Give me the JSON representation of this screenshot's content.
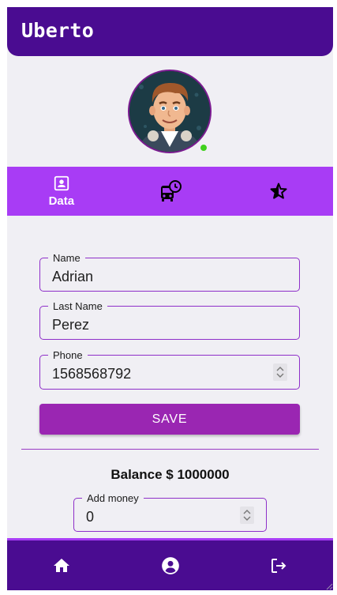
{
  "app": {
    "title": "Uberto"
  },
  "tabs": [
    {
      "label": "Data",
      "icon": "contact-card-icon",
      "active": true
    },
    {
      "label": "",
      "icon": "bus-clock-icon",
      "active": false
    },
    {
      "label": "",
      "icon": "star-half-icon",
      "active": false
    }
  ],
  "form": {
    "name": {
      "label": "Name",
      "value": "Adrian"
    },
    "last_name": {
      "label": "Last Name",
      "value": "Perez"
    },
    "phone": {
      "label": "Phone",
      "value": "1568568792"
    },
    "save_label": "SAVE"
  },
  "balance": {
    "text": "Balance $ 1000000"
  },
  "add_money": {
    "label": "Add money",
    "value": "0"
  },
  "bottom_nav": [
    "home-icon",
    "account-circle-icon",
    "logout-icon"
  ],
  "colors": {
    "primary": "#4a0c91",
    "accent": "#a83cf5",
    "button": "#9a26b2",
    "online": "#3fd11d"
  }
}
